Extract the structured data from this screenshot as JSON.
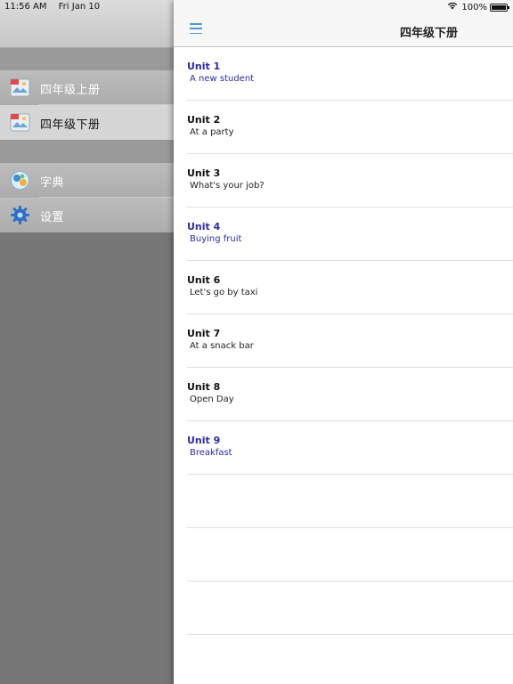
{
  "status_bar": {
    "time": "11:56 AM",
    "date": "Fri Jan 10",
    "battery": "100%"
  },
  "sidebar": {
    "items": [
      {
        "label": "四年级上册",
        "icon": "book-icon",
        "selected": false
      },
      {
        "label": "四年级下册",
        "icon": "book-icon",
        "selected": true
      },
      {
        "label": "字典",
        "icon": "dictionary-icon",
        "selected": false
      },
      {
        "label": "设置",
        "icon": "gear-icon",
        "selected": false
      }
    ]
  },
  "main": {
    "title": "四年级下册",
    "menu_icon": "menu-icon",
    "units": [
      {
        "title": "Unit 1",
        "subtitle": "A new student",
        "highlight": true
      },
      {
        "title": "Unit 2",
        "subtitle": "At a party",
        "highlight": false
      },
      {
        "title": "Unit 3",
        "subtitle": "What's your job?",
        "highlight": false
      },
      {
        "title": "Unit 4",
        "subtitle": "Buying fruit",
        "highlight": true
      },
      {
        "title": "Unit 6",
        "subtitle": "Let's go by taxi",
        "highlight": false
      },
      {
        "title": "Unit 7",
        "subtitle": "At a snack bar",
        "highlight": false
      },
      {
        "title": "Unit 8",
        "subtitle": "Open Day",
        "highlight": false
      },
      {
        "title": "Unit 9",
        "subtitle": "Breakfast",
        "highlight": true
      }
    ]
  },
  "colors": {
    "highlight_text": "#2d2aaa",
    "menu_icon": "#4a9ad8"
  }
}
